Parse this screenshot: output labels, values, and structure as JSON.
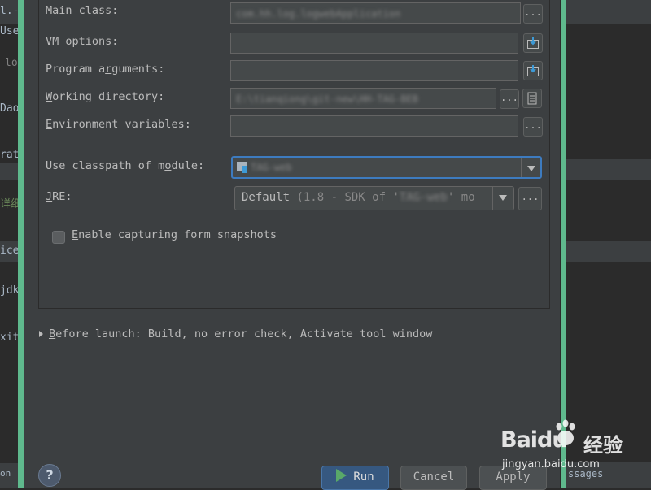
{
  "background": {
    "left_fragments": [
      "l.-",
      "Use",
      "lo",
      "Dao",
      "rat",
      "详细",
      "ice",
      "jdk",
      "xit",
      "on"
    ],
    "right_fragments": [
      "ssages"
    ]
  },
  "form": {
    "main_class": {
      "label_pre": "Main ",
      "label_u": "c",
      "label_post": "lass:",
      "value": "com.hh.log.logwebApplication",
      "button": "..."
    },
    "vm_options": {
      "label_pre": "",
      "label_u": "V",
      "label_post": "M options:",
      "value": ""
    },
    "program_arguments": {
      "label_pre": "Program a",
      "label_u": "r",
      "label_post": "guments:",
      "value": ""
    },
    "working_directory": {
      "label_pre": "",
      "label_u": "W",
      "label_post": "orking directory:",
      "value": "E:\\tianqiong\\git-new\\HH-TAG-BEB",
      "button": "..."
    },
    "environment_variables": {
      "label_pre": "",
      "label_u": "E",
      "label_post": "nvironment variables:",
      "value": "",
      "button": "..."
    },
    "classpath_module": {
      "label_pre": "Use classpath of m",
      "label_u": "o",
      "label_post": "dule:",
      "value": "TAG-web"
    },
    "jre": {
      "label_pre": "",
      "label_u": "J",
      "label_post": "RE:",
      "value_main": "Default",
      "value_detail_pre": "(1.8 - SDK of '",
      "value_detail_blur": "TAG-web",
      "value_detail_post": "' mo",
      "button": "..."
    },
    "snapshots": {
      "label_pre": "",
      "label_u": "E",
      "label_post": "nable capturing form snapshots",
      "checked": false
    }
  },
  "before_launch": {
    "label_pre": "",
    "label_u": "B",
    "label_post": "efore launch: Build, no error check, Activate tool window"
  },
  "footer": {
    "help": "?",
    "run": "Run",
    "cancel": "Cancel",
    "apply": "Apply"
  },
  "watermark": {
    "brand": "Baidu",
    "cn": "经验",
    "url": "jingyan.baidu.com"
  },
  "colors": {
    "accent": "#5fb98d",
    "focus": "#3d7bbf",
    "run": "#365880"
  }
}
